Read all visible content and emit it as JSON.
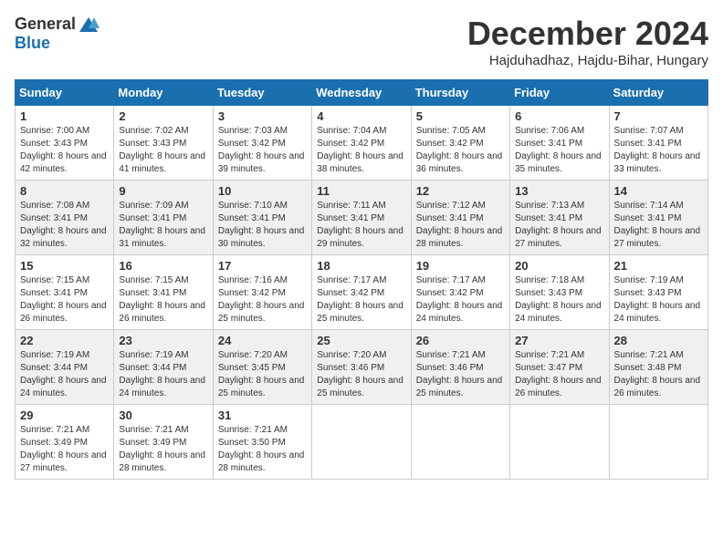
{
  "logo": {
    "general": "General",
    "blue": "Blue"
  },
  "header": {
    "month": "December 2024",
    "location": "Hajduhadhaz, Hajdu-Bihar, Hungary"
  },
  "weekdays": [
    "Sunday",
    "Monday",
    "Tuesday",
    "Wednesday",
    "Thursday",
    "Friday",
    "Saturday"
  ],
  "weeks": [
    [
      {
        "day": "1",
        "sunrise": "7:00 AM",
        "sunset": "3:43 PM",
        "daylight": "8 hours and 42 minutes."
      },
      {
        "day": "2",
        "sunrise": "7:02 AM",
        "sunset": "3:43 PM",
        "daylight": "8 hours and 41 minutes."
      },
      {
        "day": "3",
        "sunrise": "7:03 AM",
        "sunset": "3:42 PM",
        "daylight": "8 hours and 39 minutes."
      },
      {
        "day": "4",
        "sunrise": "7:04 AM",
        "sunset": "3:42 PM",
        "daylight": "8 hours and 38 minutes."
      },
      {
        "day": "5",
        "sunrise": "7:05 AM",
        "sunset": "3:42 PM",
        "daylight": "8 hours and 36 minutes."
      },
      {
        "day": "6",
        "sunrise": "7:06 AM",
        "sunset": "3:41 PM",
        "daylight": "8 hours and 35 minutes."
      },
      {
        "day": "7",
        "sunrise": "7:07 AM",
        "sunset": "3:41 PM",
        "daylight": "8 hours and 33 minutes."
      }
    ],
    [
      {
        "day": "8",
        "sunrise": "7:08 AM",
        "sunset": "3:41 PM",
        "daylight": "8 hours and 32 minutes."
      },
      {
        "day": "9",
        "sunrise": "7:09 AM",
        "sunset": "3:41 PM",
        "daylight": "8 hours and 31 minutes."
      },
      {
        "day": "10",
        "sunrise": "7:10 AM",
        "sunset": "3:41 PM",
        "daylight": "8 hours and 30 minutes."
      },
      {
        "day": "11",
        "sunrise": "7:11 AM",
        "sunset": "3:41 PM",
        "daylight": "8 hours and 29 minutes."
      },
      {
        "day": "12",
        "sunrise": "7:12 AM",
        "sunset": "3:41 PM",
        "daylight": "8 hours and 28 minutes."
      },
      {
        "day": "13",
        "sunrise": "7:13 AM",
        "sunset": "3:41 PM",
        "daylight": "8 hours and 27 minutes."
      },
      {
        "day": "14",
        "sunrise": "7:14 AM",
        "sunset": "3:41 PM",
        "daylight": "8 hours and 27 minutes."
      }
    ],
    [
      {
        "day": "15",
        "sunrise": "7:15 AM",
        "sunset": "3:41 PM",
        "daylight": "8 hours and 26 minutes."
      },
      {
        "day": "16",
        "sunrise": "7:15 AM",
        "sunset": "3:41 PM",
        "daylight": "8 hours and 26 minutes."
      },
      {
        "day": "17",
        "sunrise": "7:16 AM",
        "sunset": "3:42 PM",
        "daylight": "8 hours and 25 minutes."
      },
      {
        "day": "18",
        "sunrise": "7:17 AM",
        "sunset": "3:42 PM",
        "daylight": "8 hours and 25 minutes."
      },
      {
        "day": "19",
        "sunrise": "7:17 AM",
        "sunset": "3:42 PM",
        "daylight": "8 hours and 24 minutes."
      },
      {
        "day": "20",
        "sunrise": "7:18 AM",
        "sunset": "3:43 PM",
        "daylight": "8 hours and 24 minutes."
      },
      {
        "day": "21",
        "sunrise": "7:19 AM",
        "sunset": "3:43 PM",
        "daylight": "8 hours and 24 minutes."
      }
    ],
    [
      {
        "day": "22",
        "sunrise": "7:19 AM",
        "sunset": "3:44 PM",
        "daylight": "8 hours and 24 minutes."
      },
      {
        "day": "23",
        "sunrise": "7:19 AM",
        "sunset": "3:44 PM",
        "daylight": "8 hours and 24 minutes."
      },
      {
        "day": "24",
        "sunrise": "7:20 AM",
        "sunset": "3:45 PM",
        "daylight": "8 hours and 25 minutes."
      },
      {
        "day": "25",
        "sunrise": "7:20 AM",
        "sunset": "3:46 PM",
        "daylight": "8 hours and 25 minutes."
      },
      {
        "day": "26",
        "sunrise": "7:21 AM",
        "sunset": "3:46 PM",
        "daylight": "8 hours and 25 minutes."
      },
      {
        "day": "27",
        "sunrise": "7:21 AM",
        "sunset": "3:47 PM",
        "daylight": "8 hours and 26 minutes."
      },
      {
        "day": "28",
        "sunrise": "7:21 AM",
        "sunset": "3:48 PM",
        "daylight": "8 hours and 26 minutes."
      }
    ],
    [
      {
        "day": "29",
        "sunrise": "7:21 AM",
        "sunset": "3:49 PM",
        "daylight": "8 hours and 27 minutes."
      },
      {
        "day": "30",
        "sunrise": "7:21 AM",
        "sunset": "3:49 PM",
        "daylight": "8 hours and 28 minutes."
      },
      {
        "day": "31",
        "sunrise": "7:21 AM",
        "sunset": "3:50 PM",
        "daylight": "8 hours and 28 minutes."
      },
      null,
      null,
      null,
      null
    ]
  ]
}
